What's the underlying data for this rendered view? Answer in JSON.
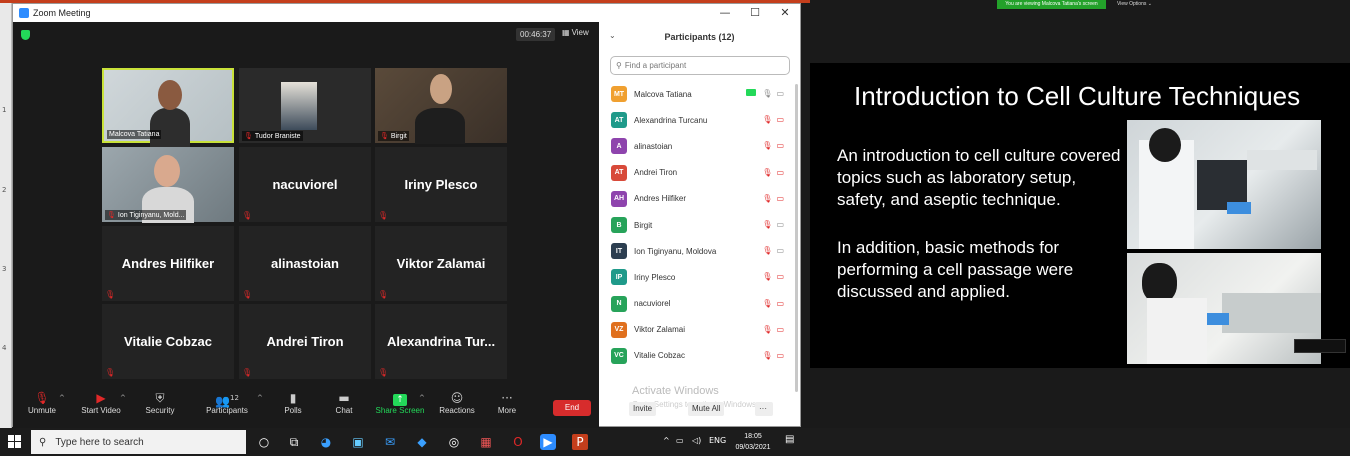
{
  "window": {
    "title": "Zoom Meeting",
    "minimize": "—",
    "maximize": "☐",
    "close": "✕"
  },
  "meeting": {
    "timer": "00:46:37",
    "view_label": "View"
  },
  "tiles": [
    {
      "name": "Malcova Tatiana",
      "video": true
    },
    {
      "name": "Tudor Braniste",
      "video": true
    },
    {
      "name": "Birgit",
      "video": true
    },
    {
      "name": "Ion Tiginyanu, Mold...",
      "video": true
    },
    {
      "name": "nacuviorel",
      "video": false
    },
    {
      "name": "Iriny Plesco",
      "video": false
    },
    {
      "name": "Andres Hilfiker",
      "video": false
    },
    {
      "name": "alinastoian",
      "video": false
    },
    {
      "name": "Viktor Zalamai",
      "video": false
    },
    {
      "name": "Vitalie Cobzac",
      "video": false
    },
    {
      "name": "Andrei Tiron",
      "video": false
    },
    {
      "name": "Alexandrina Tur...",
      "video": false
    }
  ],
  "toolbar": {
    "unmute": "Unmute",
    "start_video": "Start Video",
    "security": "Security",
    "participants": "Participants",
    "participants_count": "12",
    "polls": "Polls",
    "chat": "Chat",
    "share_screen": "Share Screen",
    "reactions": "Reactions",
    "more": "More",
    "end": "End"
  },
  "participants_panel": {
    "title": "Participants (12)",
    "search_placeholder": "Find a participant",
    "people": [
      {
        "initials": "MT",
        "name": "Malcova Tatiana",
        "color": "#f0a030"
      },
      {
        "initials": "AT",
        "name": "Alexandrina Turcanu",
        "color": "#1f9a8a"
      },
      {
        "initials": "A",
        "name": "alinastoian",
        "color": "#8e44ad"
      },
      {
        "initials": "AT",
        "name": "Andrei Tiron",
        "color": "#d84a3a"
      },
      {
        "initials": "AH",
        "name": "Andres Hilfiker",
        "color": "#8e44ad"
      },
      {
        "initials": "B",
        "name": "Birgit",
        "color": "#27a35a"
      },
      {
        "initials": "IT",
        "name": "Ion Tiginyanu, Moldova",
        "color": "#2c3e50"
      },
      {
        "initials": "IP",
        "name": "Iriny Plesco",
        "color": "#1f9a8a"
      },
      {
        "initials": "N",
        "name": "nacuviorel",
        "color": "#27a35a"
      },
      {
        "initials": "VZ",
        "name": "Viktor Zalamai",
        "color": "#e0701e"
      },
      {
        "initials": "VC",
        "name": "Vitalie Cobzac",
        "color": "#27a35a"
      }
    ],
    "activate_windows": "Activate Windows",
    "go_to_settings": "Go to Settings to activate Windows.",
    "invite": "Invite",
    "mute_all": "Mute All"
  },
  "share_bar": {
    "viewing": "You are viewing Malcova Tatiana's screen",
    "view_options": "View Options ⌄"
  },
  "slide": {
    "title": "Introduction to Cell Culture Techniques",
    "bullet1": "An introduction to cell culture covered topics such as laboratory setup, safety, and aseptic technique.",
    "bullet2": "In addition, basic methods for performing a cell passage were discussed and applied."
  },
  "taskbar": {
    "search_placeholder": "Type here to search",
    "language": "ENG",
    "time": "18:05",
    "date": "09/03/2021"
  },
  "colors": {
    "accent_green": "#23d959",
    "end_red": "#d72c2c",
    "mute_red": "#e02828",
    "zoom_blue": "#2d8cff"
  }
}
